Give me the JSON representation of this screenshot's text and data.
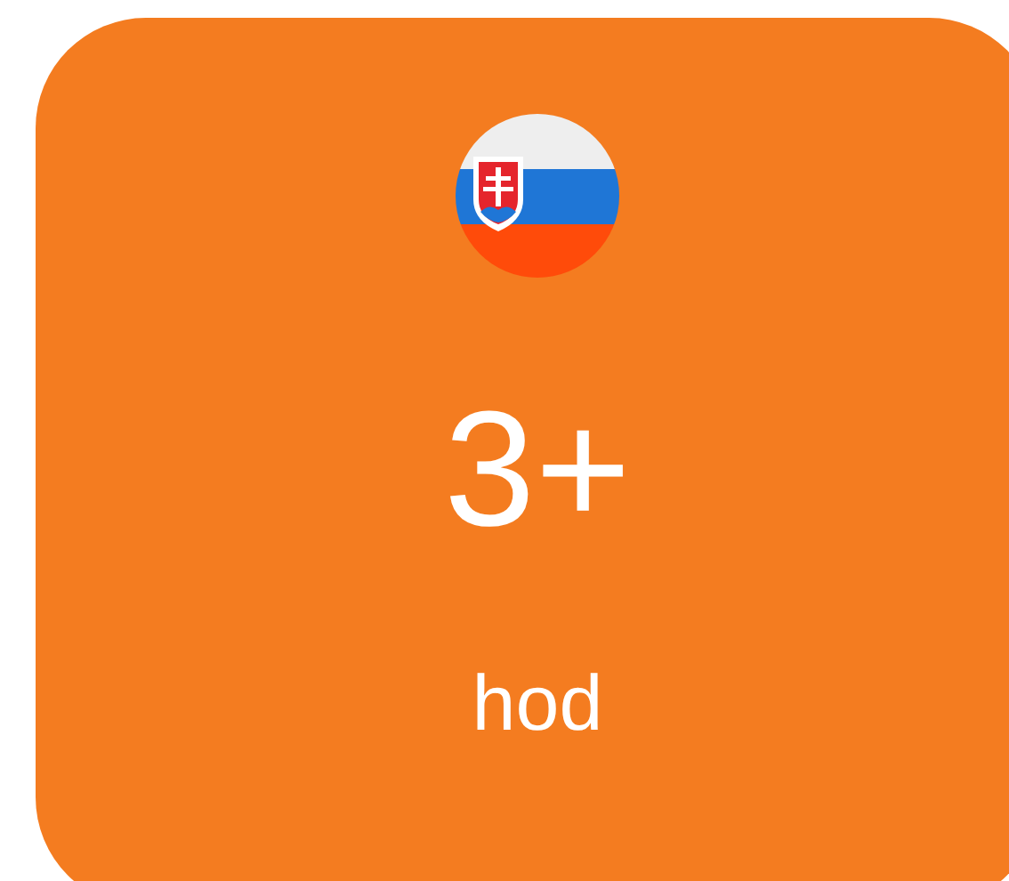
{
  "card": {
    "value": "3+",
    "unit": "hod"
  }
}
